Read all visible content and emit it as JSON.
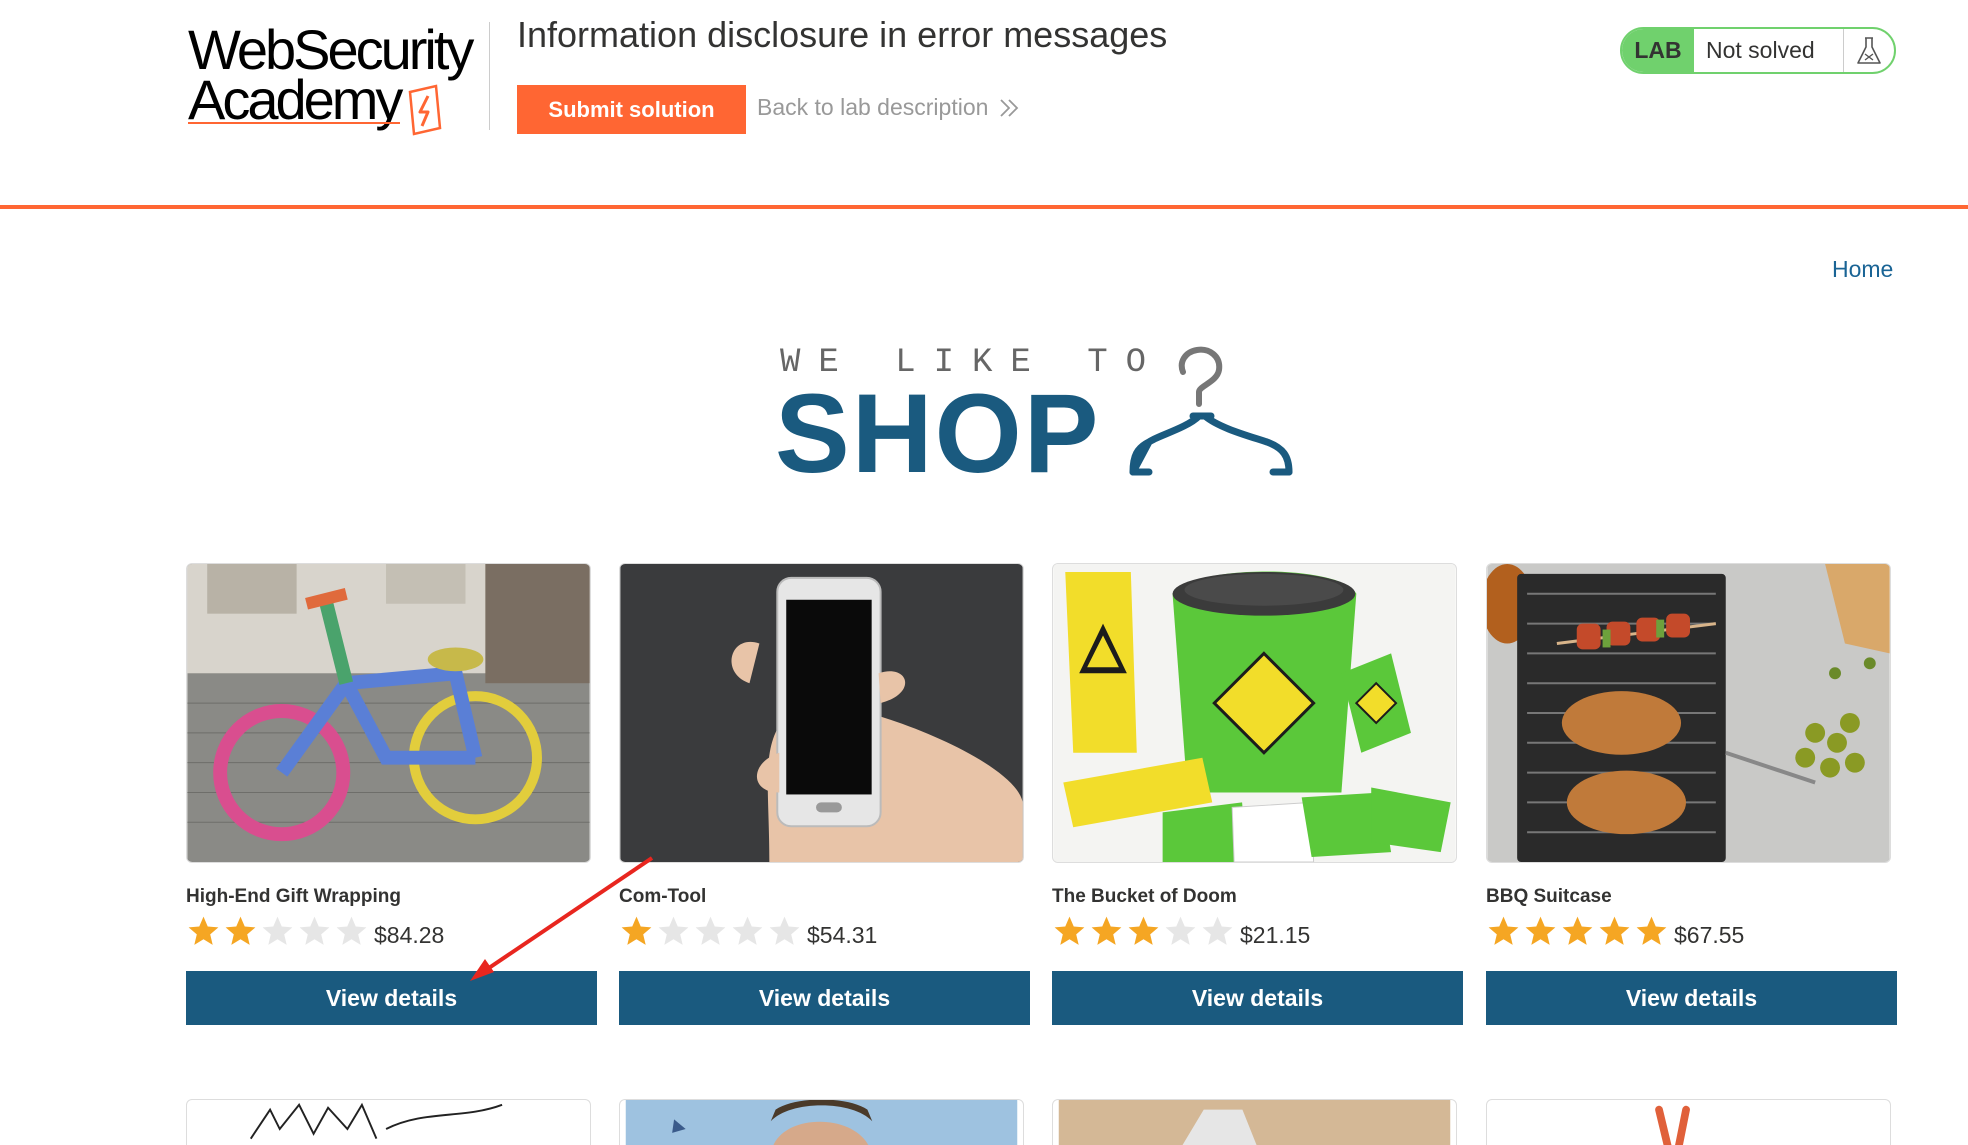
{
  "header": {
    "logo_line1": "WebSecurity",
    "logo_line2": "Academy",
    "lab_title": "Information disclosure in error messages",
    "submit_label": "Submit solution",
    "back_label": "Back to lab description",
    "lab_badge": "LAB",
    "lab_status": "Not solved",
    "accent_color": "#ff6633",
    "status_color": "#70d16d"
  },
  "nav": {
    "home_label": "Home"
  },
  "banner": {
    "sub": "WE LIKE TO",
    "main": "SHOP",
    "color": "#1a5a7f"
  },
  "products": [
    {
      "name": "High-End Gift Wrapping",
      "rating": 2,
      "price": "$84.28",
      "button": "View details",
      "image": "yarn-bombed-bicycle"
    },
    {
      "name": "Com-Tool",
      "rating": 1,
      "price": "$54.31",
      "button": "View details",
      "image": "hand-holding-phone"
    },
    {
      "name": "The Bucket of Doom",
      "rating": 3,
      "price": "$21.15",
      "button": "View details",
      "image": "bucket-of-doom-game"
    },
    {
      "name": "BBQ Suitcase",
      "rating": 5,
      "price": "$67.55",
      "button": "View details",
      "image": "portable-grill"
    }
  ],
  "partial_products": [
    "sketch-drawing",
    "man-portrait",
    "shark-fin",
    "clothes-peg"
  ],
  "colors": {
    "star_filled": "#f5a623",
    "star_empty": "#e6e6e6",
    "button_bg": "#1a5a7f"
  },
  "icons": {
    "flask": "flask-icon",
    "chevrons": "double-chevron-right-icon",
    "hanger": "coat-hanger-icon"
  }
}
